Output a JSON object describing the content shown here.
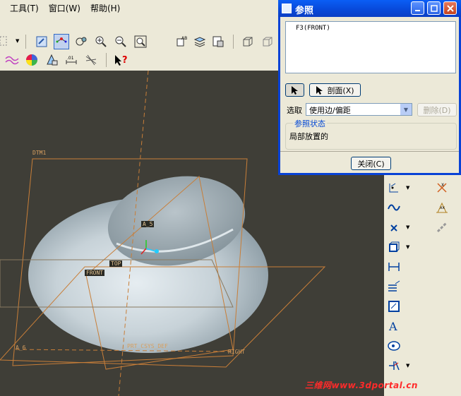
{
  "menubar": {
    "items": [
      "工具(T)",
      "窗口(W)",
      "帮助(H)"
    ]
  },
  "dialog": {
    "title": "参照",
    "references": [
      "F3(FRONT)"
    ],
    "select_button": "",
    "section_button": "剖面(X)",
    "select_label": "选取",
    "select_value": "使用边/偏距",
    "delete_button": "删除(D)",
    "group_title": "参照状态",
    "status": "局部放置的",
    "close_button": "关闭(C)"
  },
  "model_labels": {
    "dtm1": "DTM1",
    "a5": "A_5",
    "top": "TOP",
    "front": "FRONT",
    "a6": "A_6",
    "csys": "PRT_CSYS_DEF",
    "right": "RIGHT"
  },
  "watermark": "三维网www.3dportal.cn",
  "colors": {
    "viewport_bg": "#3f3e37",
    "datum_orange": "#d88a3a",
    "title_blue": "#0a5ef5",
    "watermark_red": "#ff2a2a"
  }
}
